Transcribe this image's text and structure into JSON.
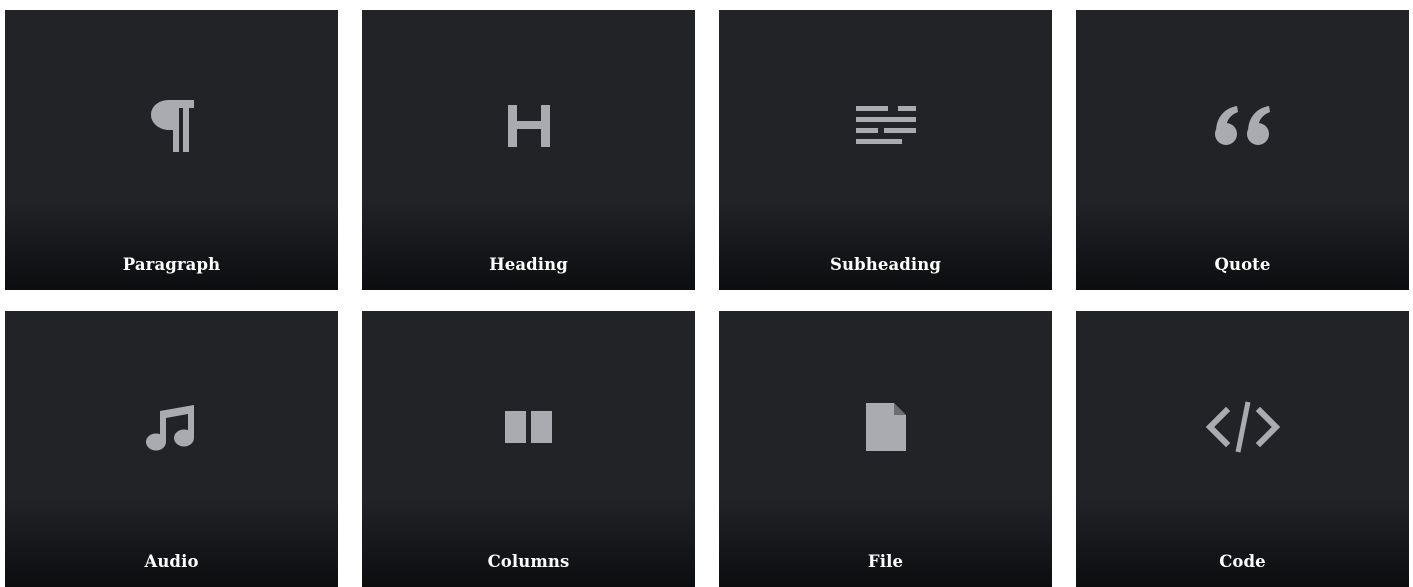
{
  "colors": {
    "tile_background": "#212327",
    "tile_bottom": "#0c0d0f",
    "icon": "#a9abb0",
    "label": "#ffffff",
    "page_background": "#ffffff"
  },
  "blocks": [
    {
      "label": "Paragraph",
      "icon": "paragraph-icon"
    },
    {
      "label": "Heading",
      "icon": "heading-icon"
    },
    {
      "label": "Subheading",
      "icon": "subheading-icon"
    },
    {
      "label": "Quote",
      "icon": "quote-icon"
    },
    {
      "label": "Audio",
      "icon": "music-note-icon"
    },
    {
      "label": "Columns",
      "icon": "columns-icon"
    },
    {
      "label": "File",
      "icon": "file-icon"
    },
    {
      "label": "Code",
      "icon": "code-icon"
    }
  ]
}
